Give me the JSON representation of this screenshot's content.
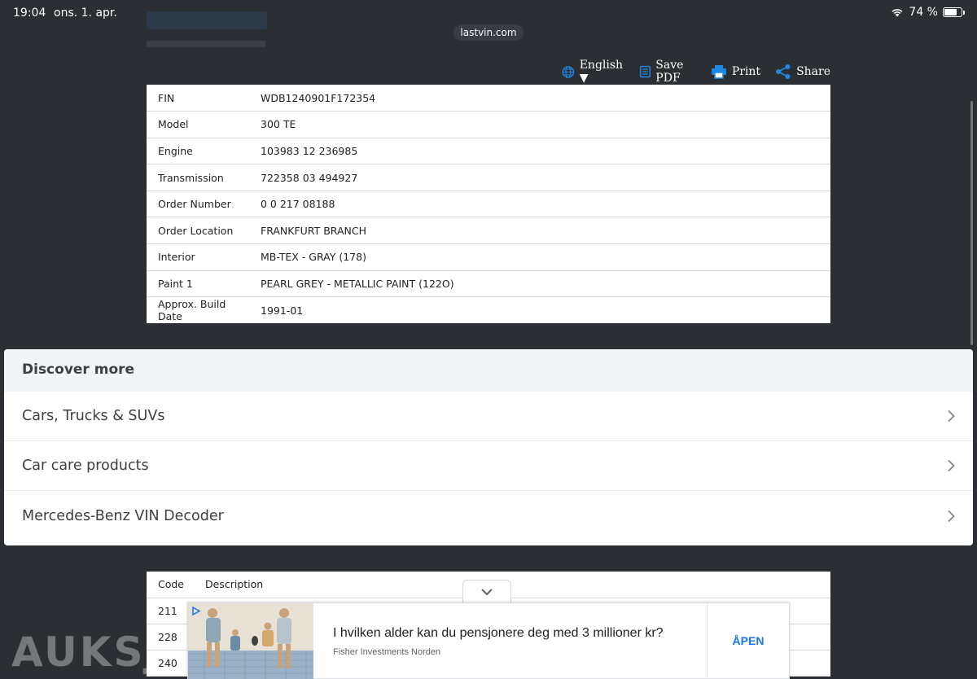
{
  "status_bar": {
    "time": "19:04",
    "date": "ons. 1. apr.",
    "battery": "74 %",
    "battery_level": 0.74
  },
  "browser": {
    "url": "lastvin.com"
  },
  "toolbar": {
    "language": "English ▼",
    "save_pdf": "Save PDF",
    "print": "Print",
    "share": "Share"
  },
  "vehicle_info": {
    "rows": [
      {
        "label": "FIN",
        "value": "WDB1240901F172354"
      },
      {
        "label": "Model",
        "value": "300 TE"
      },
      {
        "label": "Engine",
        "value": "103983 12 236985"
      },
      {
        "label": "Transmission",
        "value": "722358 03 494927"
      },
      {
        "label": "Order Number",
        "value": "0 0 217 08188"
      },
      {
        "label": "Order Location",
        "value": "FRANKFURT BRANCH"
      },
      {
        "label": "Interior",
        "value": "MB-TEX - GRAY (178)"
      },
      {
        "label": "Paint 1",
        "value": "PEARL GREY - METALLIC PAINT (122O)"
      },
      {
        "label": "Approx. Build Date",
        "value": "1991-01"
      }
    ]
  },
  "discover": {
    "title": "Discover more",
    "items": [
      {
        "label": "Cars, Trucks & SUVs"
      },
      {
        "label": "Car care products"
      },
      {
        "label": "Mercedes-Benz VIN Decoder"
      }
    ]
  },
  "codes": {
    "headers": {
      "code": "Code",
      "description": "Description"
    },
    "rows": [
      {
        "code": "211",
        "description": ""
      },
      {
        "code": "228",
        "description": ""
      },
      {
        "code": "240",
        "description": ""
      }
    ]
  },
  "ad": {
    "headline": "I hvilken alder kan du pensjonere deg med 3 millioner kr?",
    "advertiser": "Fisher Investments Norden",
    "cta": "ÅPEN"
  },
  "watermark": "AUKSJONEN",
  "colors": {
    "background": "#2b2e33",
    "accent": "#1a73e8",
    "icon_blue": "#1e88e5"
  }
}
